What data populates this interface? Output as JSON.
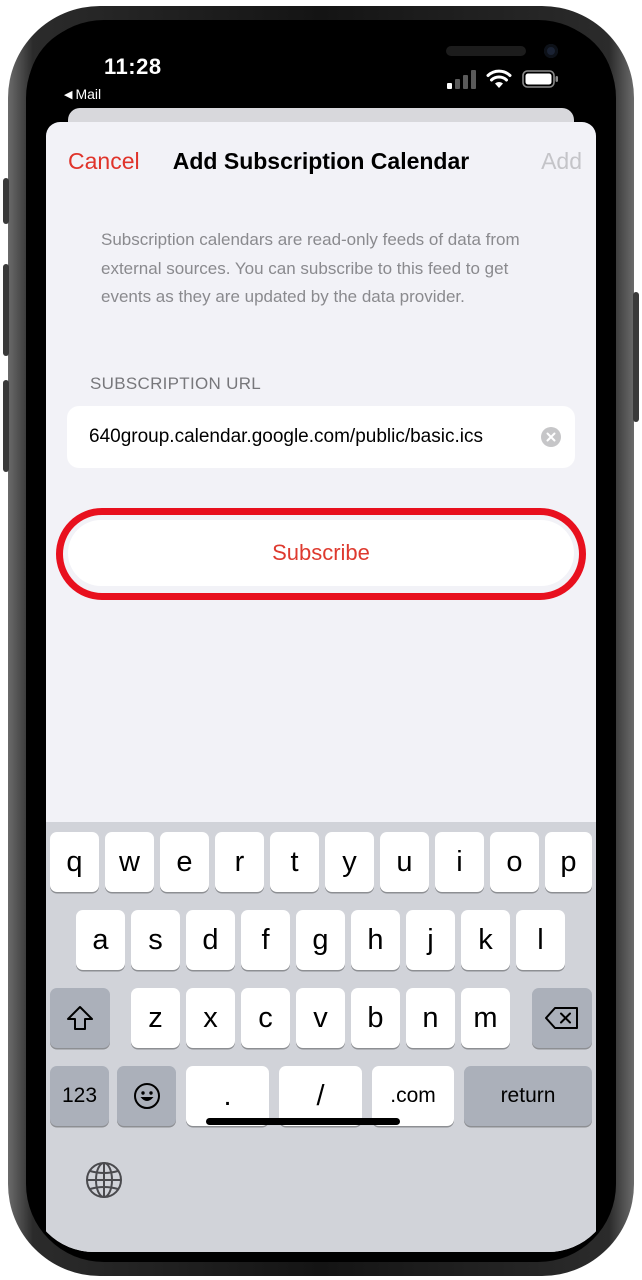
{
  "status_bar": {
    "time": "11:28",
    "back_app": "Mail",
    "signal_icon": "cellular-signal-icon",
    "wifi_icon": "wifi-icon",
    "battery_icon": "battery-icon"
  },
  "nav": {
    "cancel": "Cancel",
    "title": "Add Subscription Calendar",
    "add": "Add"
  },
  "description": "Subscription calendars are read-only feeds of data from external sources. You can subscribe to this feed to get events as they are updated by the data provider.",
  "url_section": {
    "label": "SUBSCRIPTION URL",
    "value": "640group.calendar.google.com/public/basic.ics"
  },
  "subscribe_label": "Subscribe",
  "keyboard": {
    "row1": [
      "q",
      "w",
      "e",
      "r",
      "t",
      "y",
      "u",
      "i",
      "o",
      "p"
    ],
    "row2": [
      "a",
      "s",
      "d",
      "f",
      "g",
      "h",
      "j",
      "k",
      "l"
    ],
    "row3": [
      "z",
      "x",
      "c",
      "v",
      "b",
      "n",
      "m"
    ],
    "bottom": {
      "numbers": "123",
      "emoji_icon": "emoji-icon",
      "dot": ".",
      "slash": "/",
      "dotcom": ".com",
      "return": "return"
    },
    "shift_icon": "shift-icon",
    "backspace_icon": "backspace-icon",
    "globe_icon": "globe-icon"
  },
  "colors": {
    "accent_red": "#e0332a",
    "highlight_ring": "#e8101e",
    "sheet_background": "#f2f2f7",
    "keyboard_background": "#d1d3d9"
  }
}
